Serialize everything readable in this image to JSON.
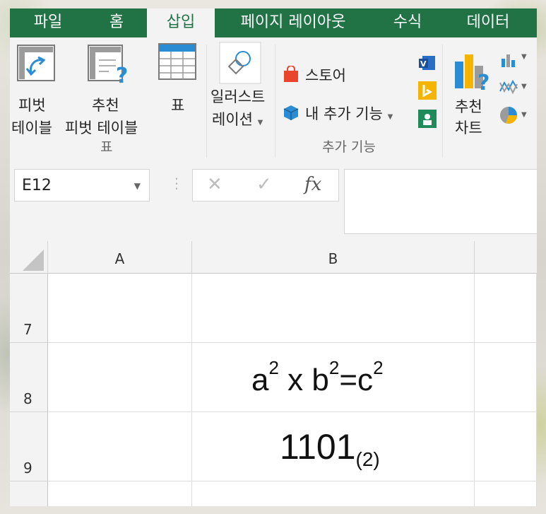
{
  "tabs": [
    "파일",
    "홈",
    "삽입",
    "페이지 레이아웃",
    "수식",
    "데이터"
  ],
  "ribbon": {
    "pivot_table": [
      "피벗",
      "테이블"
    ],
    "recommended_pivot": [
      "추천",
      "피벗 테이블"
    ],
    "table": "표",
    "group_tables": "표",
    "illustrations": [
      "일러스트",
      "레이션"
    ],
    "store": "스토어",
    "my_addins": "내 추가 기능",
    "group_addins": "추가 기능",
    "recommended_chart": [
      "추천",
      "차트"
    ]
  },
  "formula_bar": {
    "name_box": "E12",
    "fx": "fx",
    "content": ""
  },
  "columns": [
    "A",
    "B"
  ],
  "rows": [
    {
      "num": "7",
      "b": ""
    },
    {
      "num": "8",
      "b_parts": {
        "a": "a",
        "a_exp": "2",
        "x": " x ",
        "b": "b",
        "b_exp": "2",
        "eq": "=c",
        "c_exp": "2"
      }
    },
    {
      "num": "9",
      "b_parts": {
        "base": "1101",
        "sub": "(2)"
      }
    }
  ],
  "colors": {
    "accent": "#217346",
    "ribbon_bg": "#f3f3f3"
  }
}
